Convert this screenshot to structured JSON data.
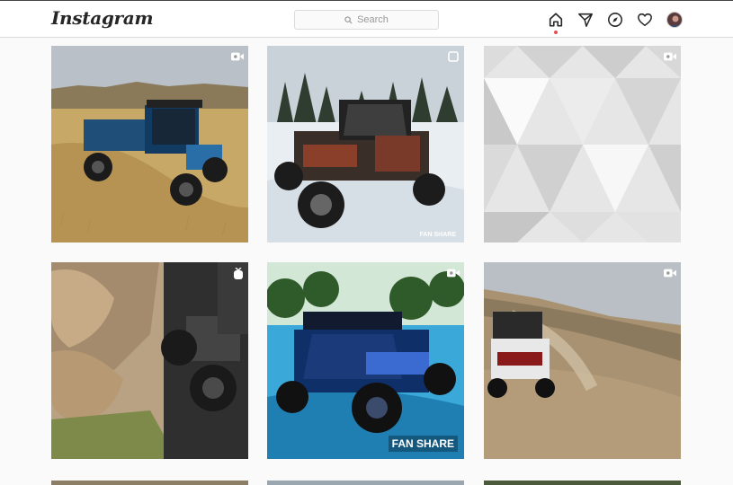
{
  "header": {
    "logo_text": "Instagram",
    "search_placeholder": "Search",
    "nav_icons": [
      "home-icon",
      "direct-icon",
      "explore-icon",
      "activity-icon",
      "profile-avatar"
    ],
    "active_nav": "home-icon",
    "notification_dot_color": "#ed4956"
  },
  "posts": [
    {
      "badge": "video-icon",
      "overlay_text": ""
    },
    {
      "badge": "carousel-icon",
      "overlay_text": "FAN SHARE"
    },
    {
      "badge": "video-icon",
      "overlay_text": ""
    },
    {
      "badge": "igtv-icon",
      "overlay_text": ""
    },
    {
      "badge": "video-icon",
      "overlay_text": "FAN SHARE"
    },
    {
      "badge": "video-icon",
      "overlay_text": ""
    }
  ]
}
